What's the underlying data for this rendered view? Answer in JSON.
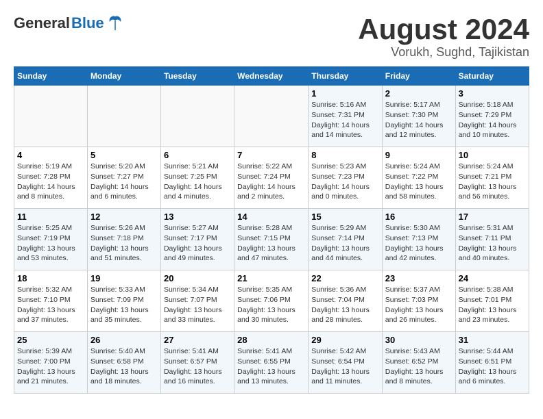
{
  "header": {
    "logo_general": "General",
    "logo_blue": "Blue",
    "month_year": "August 2024",
    "location": "Vorukh, Sughd, Tajikistan"
  },
  "calendar": {
    "days_of_week": [
      "Sunday",
      "Monday",
      "Tuesday",
      "Wednesday",
      "Thursday",
      "Friday",
      "Saturday"
    ],
    "weeks": [
      [
        {
          "day": "",
          "content": ""
        },
        {
          "day": "",
          "content": ""
        },
        {
          "day": "",
          "content": ""
        },
        {
          "day": "",
          "content": ""
        },
        {
          "day": "1",
          "content": "Sunrise: 5:16 AM\nSunset: 7:31 PM\nDaylight: 14 hours and 14 minutes."
        },
        {
          "day": "2",
          "content": "Sunrise: 5:17 AM\nSunset: 7:30 PM\nDaylight: 14 hours and 12 minutes."
        },
        {
          "day": "3",
          "content": "Sunrise: 5:18 AM\nSunset: 7:29 PM\nDaylight: 14 hours and 10 minutes."
        }
      ],
      [
        {
          "day": "4",
          "content": "Sunrise: 5:19 AM\nSunset: 7:28 PM\nDaylight: 14 hours and 8 minutes."
        },
        {
          "day": "5",
          "content": "Sunrise: 5:20 AM\nSunset: 7:27 PM\nDaylight: 14 hours and 6 minutes."
        },
        {
          "day": "6",
          "content": "Sunrise: 5:21 AM\nSunset: 7:25 PM\nDaylight: 14 hours and 4 minutes."
        },
        {
          "day": "7",
          "content": "Sunrise: 5:22 AM\nSunset: 7:24 PM\nDaylight: 14 hours and 2 minutes."
        },
        {
          "day": "8",
          "content": "Sunrise: 5:23 AM\nSunset: 7:23 PM\nDaylight: 14 hours and 0 minutes."
        },
        {
          "day": "9",
          "content": "Sunrise: 5:24 AM\nSunset: 7:22 PM\nDaylight: 13 hours and 58 minutes."
        },
        {
          "day": "10",
          "content": "Sunrise: 5:24 AM\nSunset: 7:21 PM\nDaylight: 13 hours and 56 minutes."
        }
      ],
      [
        {
          "day": "11",
          "content": "Sunrise: 5:25 AM\nSunset: 7:19 PM\nDaylight: 13 hours and 53 minutes."
        },
        {
          "day": "12",
          "content": "Sunrise: 5:26 AM\nSunset: 7:18 PM\nDaylight: 13 hours and 51 minutes."
        },
        {
          "day": "13",
          "content": "Sunrise: 5:27 AM\nSunset: 7:17 PM\nDaylight: 13 hours and 49 minutes."
        },
        {
          "day": "14",
          "content": "Sunrise: 5:28 AM\nSunset: 7:15 PM\nDaylight: 13 hours and 47 minutes."
        },
        {
          "day": "15",
          "content": "Sunrise: 5:29 AM\nSunset: 7:14 PM\nDaylight: 13 hours and 44 minutes."
        },
        {
          "day": "16",
          "content": "Sunrise: 5:30 AM\nSunset: 7:13 PM\nDaylight: 13 hours and 42 minutes."
        },
        {
          "day": "17",
          "content": "Sunrise: 5:31 AM\nSunset: 7:11 PM\nDaylight: 13 hours and 40 minutes."
        }
      ],
      [
        {
          "day": "18",
          "content": "Sunrise: 5:32 AM\nSunset: 7:10 PM\nDaylight: 13 hours and 37 minutes."
        },
        {
          "day": "19",
          "content": "Sunrise: 5:33 AM\nSunset: 7:09 PM\nDaylight: 13 hours and 35 minutes."
        },
        {
          "day": "20",
          "content": "Sunrise: 5:34 AM\nSunset: 7:07 PM\nDaylight: 13 hours and 33 minutes."
        },
        {
          "day": "21",
          "content": "Sunrise: 5:35 AM\nSunset: 7:06 PM\nDaylight: 13 hours and 30 minutes."
        },
        {
          "day": "22",
          "content": "Sunrise: 5:36 AM\nSunset: 7:04 PM\nDaylight: 13 hours and 28 minutes."
        },
        {
          "day": "23",
          "content": "Sunrise: 5:37 AM\nSunset: 7:03 PM\nDaylight: 13 hours and 26 minutes."
        },
        {
          "day": "24",
          "content": "Sunrise: 5:38 AM\nSunset: 7:01 PM\nDaylight: 13 hours and 23 minutes."
        }
      ],
      [
        {
          "day": "25",
          "content": "Sunrise: 5:39 AM\nSunset: 7:00 PM\nDaylight: 13 hours and 21 minutes."
        },
        {
          "day": "26",
          "content": "Sunrise: 5:40 AM\nSunset: 6:58 PM\nDaylight: 13 hours and 18 minutes."
        },
        {
          "day": "27",
          "content": "Sunrise: 5:41 AM\nSunset: 6:57 PM\nDaylight: 13 hours and 16 minutes."
        },
        {
          "day": "28",
          "content": "Sunrise: 5:41 AM\nSunset: 6:55 PM\nDaylight: 13 hours and 13 minutes."
        },
        {
          "day": "29",
          "content": "Sunrise: 5:42 AM\nSunset: 6:54 PM\nDaylight: 13 hours and 11 minutes."
        },
        {
          "day": "30",
          "content": "Sunrise: 5:43 AM\nSunset: 6:52 PM\nDaylight: 13 hours and 8 minutes."
        },
        {
          "day": "31",
          "content": "Sunrise: 5:44 AM\nSunset: 6:51 PM\nDaylight: 13 hours and 6 minutes."
        }
      ]
    ]
  }
}
